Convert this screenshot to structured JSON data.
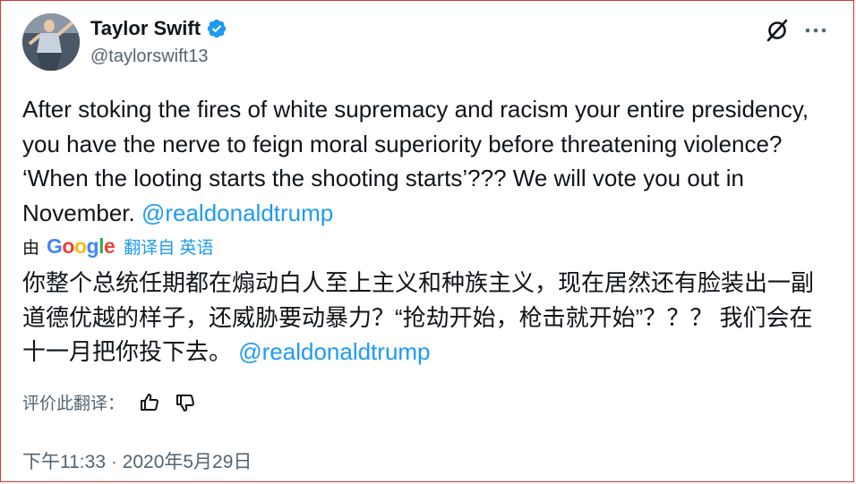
{
  "author": {
    "display_name": "Taylor Swift",
    "handle": "@taylorswift13",
    "verified": true
  },
  "tweet": {
    "text": "After stoking the fires of white supremacy and racism your entire presidency, you have the nerve to feign moral superiority before threatening violence? ‘When the looting starts the shooting starts’??? We will vote you out in November. ",
    "mention": "@realdonaldtrump"
  },
  "translation": {
    "by_label": "由",
    "google_letters": [
      "G",
      "o",
      "o",
      "g",
      "l",
      "e"
    ],
    "translated_from_label": "翻译自 英语",
    "text": "你整个总统任期都在煽动白人至上主义和种族主义，现在居然还有脸装出一副道德优越的样子，还威胁要动暴力？“抢劫开始，枪击就开始”？？？ 我们会在十一月把你投下去。 ",
    "mention": "@realdonaldtrump",
    "rate_label": "评价此翻译："
  },
  "timestamp": "下午11:33 · 2020年5月29日",
  "colors": {
    "accent": "#1d9bf0",
    "text": "#0f1419",
    "secondary": "#536471",
    "border": "#d9352f"
  },
  "icons": [
    "verified-badge-icon",
    "grok-icon",
    "more-icon",
    "thumbs-up-icon",
    "thumbs-down-icon"
  ]
}
